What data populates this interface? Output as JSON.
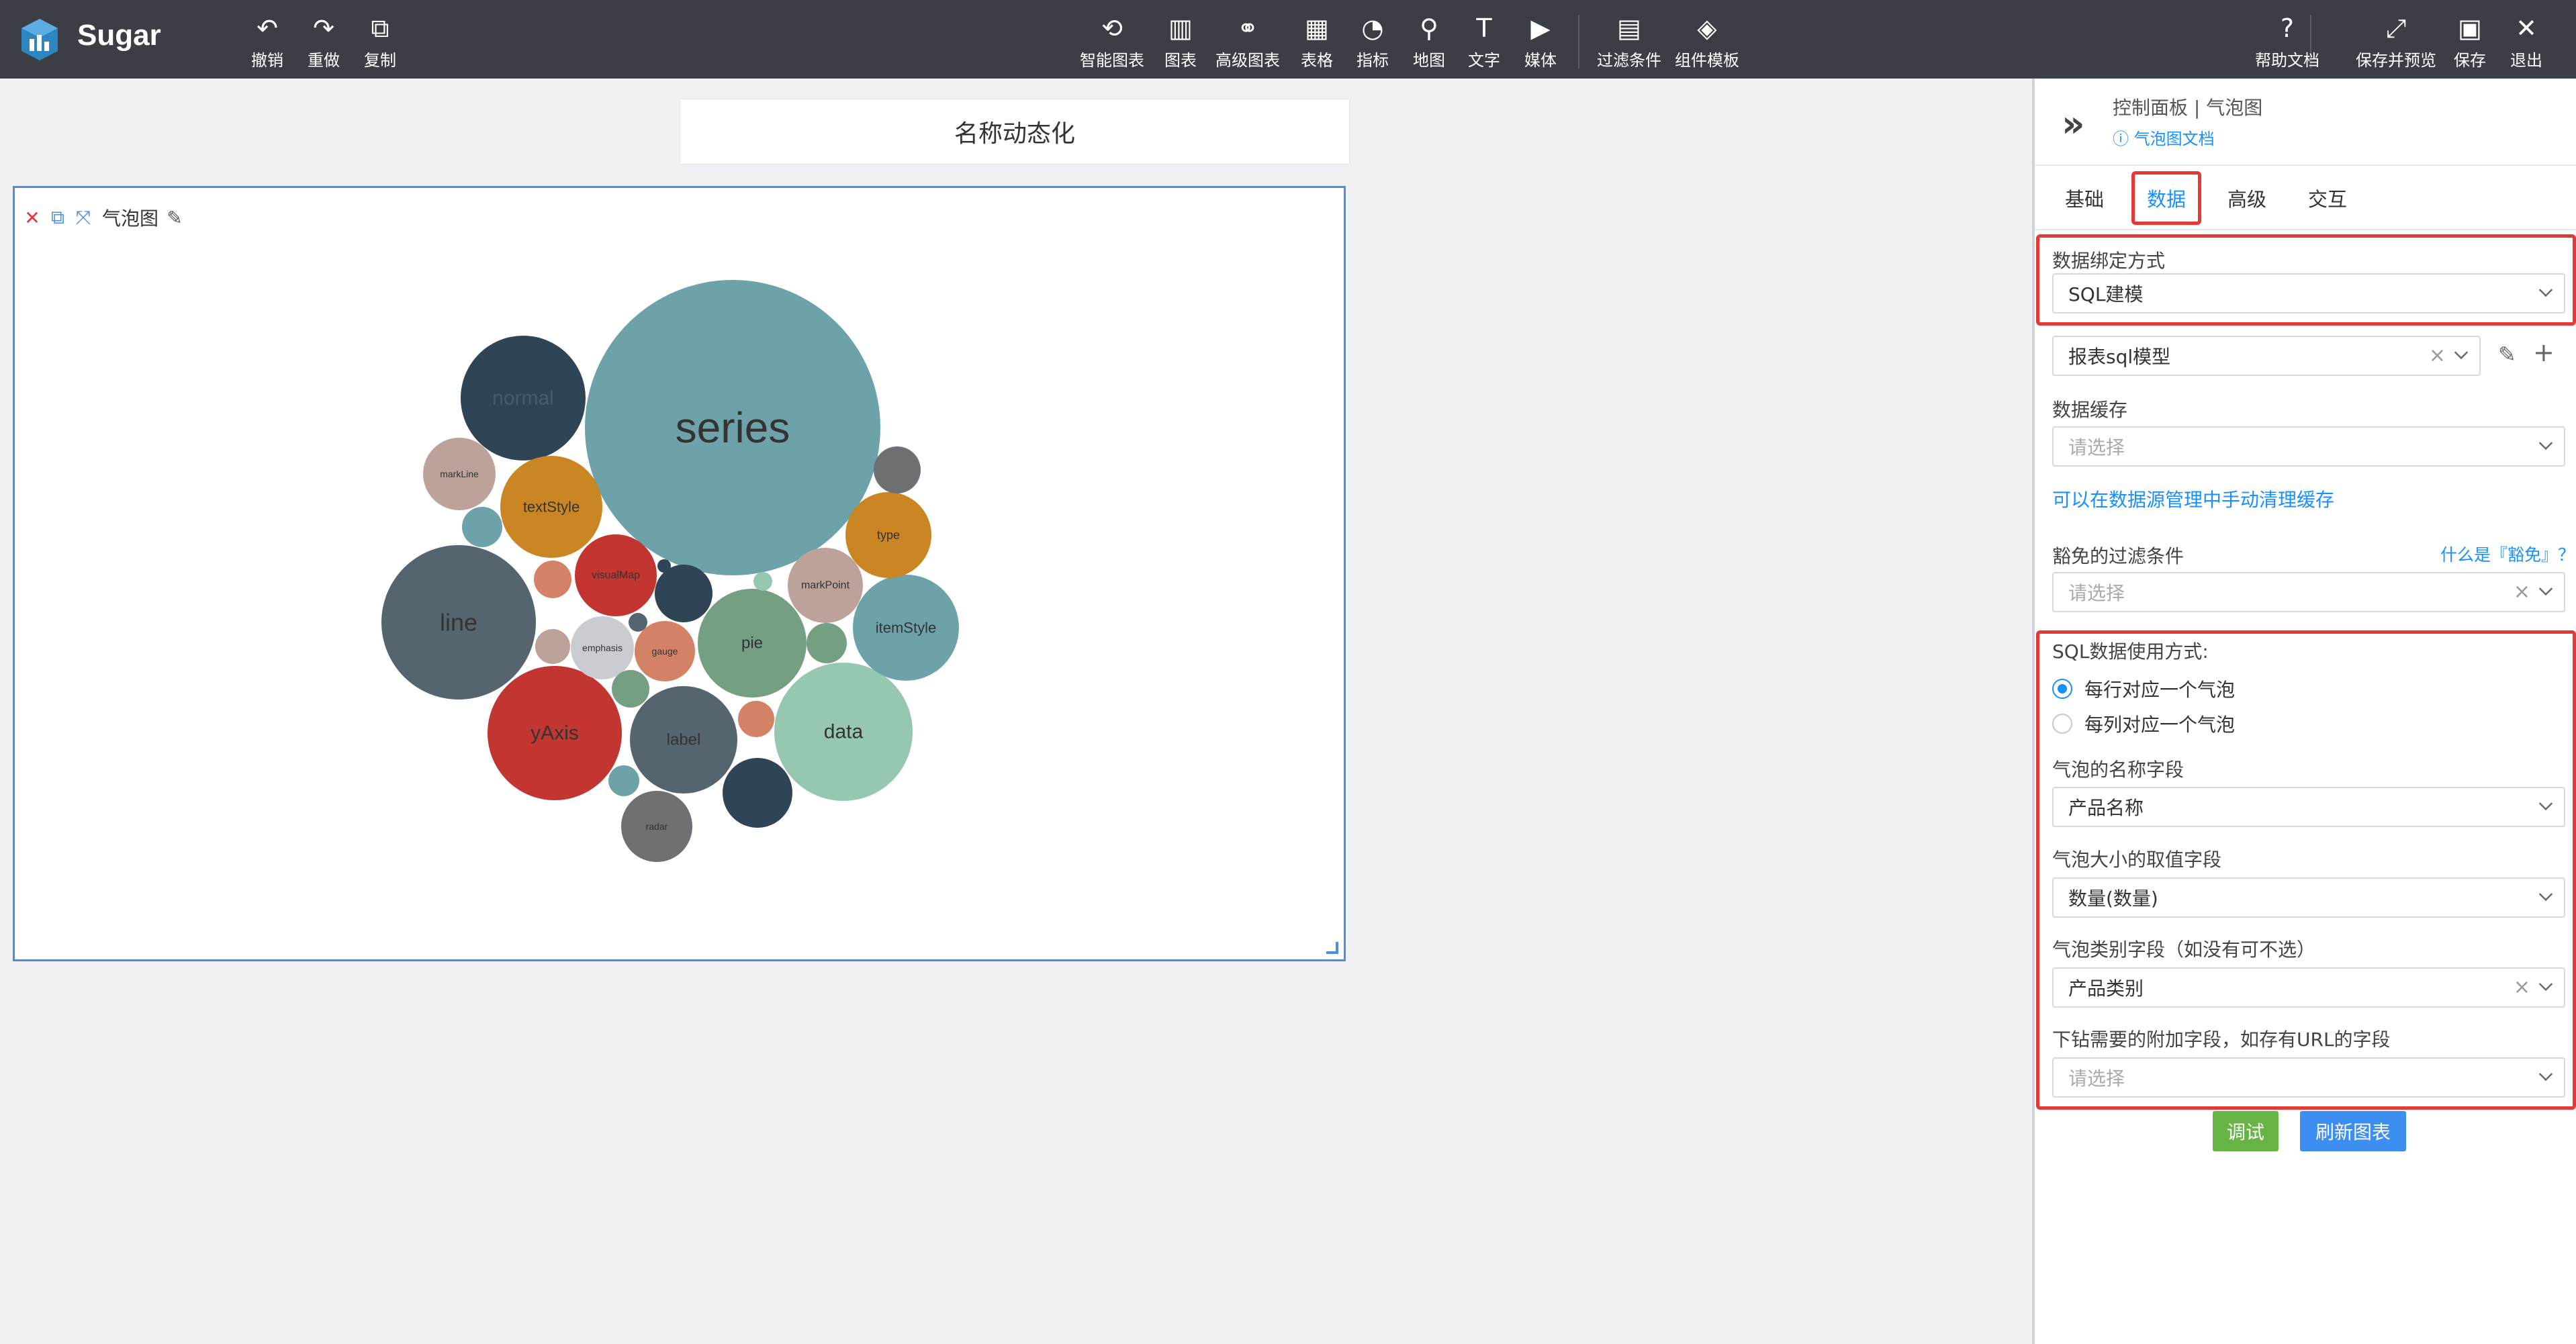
{
  "app": {
    "name": "Sugar"
  },
  "toolbar_left": [
    {
      "label": "撤销",
      "icon": "undo-icon",
      "glyph": "↶"
    },
    {
      "label": "重做",
      "icon": "redo-icon",
      "glyph": "↷"
    },
    {
      "label": "复制",
      "icon": "copy-icon",
      "glyph": "⧉"
    }
  ],
  "toolbar_center": [
    {
      "label": "智能图表",
      "icon": "smart-chart-icon",
      "glyph": "⟲"
    },
    {
      "label": "图表",
      "icon": "bar-chart-icon",
      "glyph": "▥"
    },
    {
      "label": "高级图表",
      "icon": "advanced-chart-icon",
      "glyph": "⚭"
    },
    {
      "label": "表格",
      "icon": "table-icon",
      "glyph": "▦"
    },
    {
      "label": "指标",
      "icon": "gauge-icon",
      "glyph": "◔"
    },
    {
      "label": "地图",
      "icon": "map-pin-icon",
      "glyph": "⚲"
    },
    {
      "label": "文字",
      "icon": "text-icon",
      "glyph": "T"
    },
    {
      "label": "媒体",
      "icon": "media-icon",
      "glyph": "▶"
    },
    {
      "label": "过滤条件",
      "icon": "filter-icon",
      "glyph": "▤"
    },
    {
      "label": "组件模板",
      "icon": "template-icon",
      "glyph": "◈"
    }
  ],
  "toolbar_right": [
    {
      "label": "帮助文档",
      "icon": "help-icon",
      "glyph": "?"
    },
    {
      "label": "保存并预览",
      "icon": "expand-icon",
      "glyph": "⤢"
    },
    {
      "label": "保存",
      "icon": "save-icon",
      "glyph": "▣"
    },
    {
      "label": "退出",
      "icon": "close-icon",
      "glyph": "✕"
    }
  ],
  "dashboard": {
    "title": "名称动态化"
  },
  "widget": {
    "name": "气泡图"
  },
  "chart_data": {
    "type": "bubble",
    "title": "",
    "bubbles": [
      {
        "name": "series",
        "value": 100,
        "color": "#6ca2a8"
      },
      {
        "name": "normal",
        "value": 18,
        "color": "#2f4555"
      },
      {
        "name": "line",
        "value": 28,
        "color": "#556570"
      },
      {
        "name": "yAxis",
        "value": 21,
        "color": "#c23531"
      },
      {
        "name": "data",
        "value": 22,
        "color": "#96c7b0"
      },
      {
        "name": "label",
        "value": 13,
        "color": "#546570"
      },
      {
        "name": "pie",
        "value": 14,
        "color": "#749f83"
      },
      {
        "name": "itemStyle",
        "value": 13,
        "color": "#6ca2a8"
      },
      {
        "name": "textStyle",
        "value": 12,
        "color": "#ca8622"
      },
      {
        "name": "type",
        "value": 9,
        "color": "#ca8622"
      },
      {
        "name": "markPoint",
        "value": 7,
        "color": "#bda29a"
      },
      {
        "name": "visualMap",
        "value": 8,
        "color": "#c23531"
      },
      {
        "name": "markLine",
        "value": 6,
        "color": "#bda29a"
      },
      {
        "name": "emphasis",
        "value": 4,
        "color": "#c9cdd2"
      },
      {
        "name": "gauge",
        "value": 4,
        "color": "#d48265"
      },
      {
        "name": "radar",
        "value": 6,
        "color": "#6e7074"
      },
      {
        "name": "",
        "value": 5,
        "color": "#2f4555"
      },
      {
        "name": "",
        "value": 5,
        "color": "#2f4555"
      },
      {
        "name": "",
        "value": 2,
        "color": "#6e7074"
      },
      {
        "name": "",
        "value": 1.5,
        "color": "#6ca2a8"
      },
      {
        "name": "",
        "value": 1,
        "color": "#d48265"
      },
      {
        "name": "",
        "value": 1,
        "color": "#bda29a"
      },
      {
        "name": "",
        "value": 1,
        "color": "#749f83"
      },
      {
        "name": "",
        "value": 1,
        "color": "#749f83"
      },
      {
        "name": "",
        "value": 1,
        "color": "#d48265"
      },
      {
        "name": "",
        "value": 0.8,
        "color": "#6ca2a8"
      },
      {
        "name": "",
        "value": 0.3,
        "color": "#556570"
      },
      {
        "name": "",
        "value": 0.2,
        "color": "#96c7b0"
      },
      {
        "name": "",
        "value": 0.2,
        "color": "#2f4555"
      }
    ]
  },
  "panel": {
    "breadcrumb": "控制面板 | 气泡图",
    "doc_link": "气泡图文档",
    "tabs": [
      "基础",
      "数据",
      "高级",
      "交互"
    ],
    "active_tab": "数据",
    "binding_label": "数据绑定方式",
    "binding_value": "SQL建模",
    "model_value": "报表sql模型",
    "cache_label": "数据缓存",
    "cache_placeholder": "请选择",
    "cache_link": "可以在数据源管理中手动清理缓存",
    "exempt_label": "豁免的过滤条件",
    "exempt_help": "什么是『豁免』？",
    "exempt_placeholder": "请选择",
    "sql_usage_label": "SQL数据使用方式:",
    "radio_row": "每行对应一个气泡",
    "radio_col": "每列对应一个气泡",
    "name_field_label": "气泡的名称字段",
    "name_field_value": "产品名称",
    "size_field_label": "气泡大小的取值字段",
    "size_field_value": "数量(数量)",
    "category_field_label": "气泡类别字段（如没有可不选）",
    "category_field_value": "产品类别",
    "drill_field_label": "下钻需要的附加字段，如存有URL的字段",
    "drill_field_placeholder": "请选择",
    "debug_button": "调试",
    "refresh_button": "刷新图表",
    "debug_color": "#67b346",
    "refresh_color": "#3c8ff0"
  }
}
